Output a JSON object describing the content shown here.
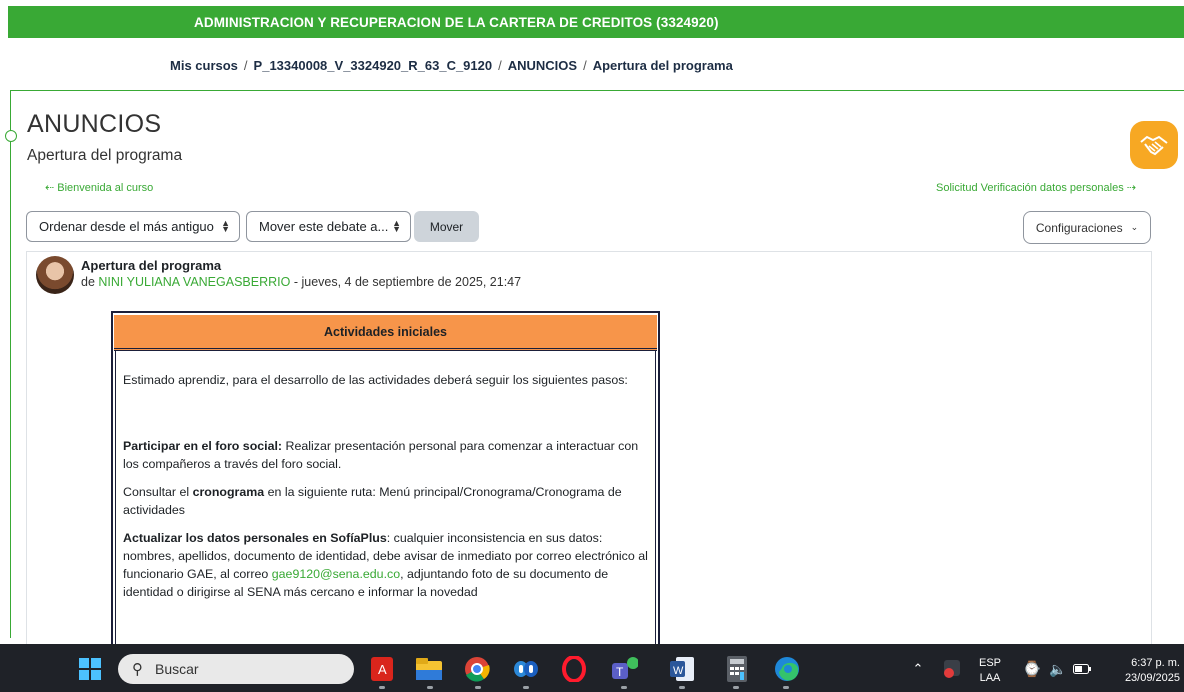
{
  "course_bar": {
    "title": "ADMINISTRACION Y RECUPERACION DE LA CARTERA DE CREDITOS (3324920)"
  },
  "breadcrumb": {
    "items": [
      "Mis cursos",
      "P_13340008_V_3324920_R_63_C_9120",
      "ANUNCIOS",
      "Apertura del programa"
    ],
    "separator": "/"
  },
  "page": {
    "title": "ANUNCIOS",
    "subtitle": "Apertura del programa",
    "prev_link": "Bienvenida al curso",
    "next_link": "Solicitud Verificación datos personales"
  },
  "controls": {
    "order_select": "Ordenar desde el más antiguo",
    "move_select": "Mover este debate a...",
    "move_button": "Mover",
    "settings_button": "Configuraciones"
  },
  "post": {
    "title": "Apertura del programa",
    "by": "de",
    "author": "NINI YULIANA VANEGASBERRIO",
    "date": "- jueves, 4 de septiembre de 2025, 21:47",
    "box_header": "Actividades iniciales",
    "intro": "Estimado aprendiz, para el desarrollo de las actividades deberá seguir los siguientes pasos:",
    "p1_bold": "Participar en el foro social:",
    "p1_text": " Realizar presentación personal para comenzar a interactuar con los compañeros a través del foro social.",
    "p2_pre": "Consultar el ",
    "p2_bold": "cronograma",
    "p2_text": " en la siguiente ruta: Menú principal/Cronograma/Cronograma de actividades",
    "p3_bold": "Actualizar los datos personales en SofíaPlus",
    "p3_text": ": cualquier inconsistencia en sus datos: nombres, apellidos, documento de identidad, debe avisar de inmediato por correo electrónico al funcionario GAE, al correo ",
    "p3_email": "gae9120@sena.edu.co",
    "p3_tail": ", adjuntando foto de su documento de identidad o dirigirse al SENA más cercano e informar la novedad"
  },
  "taskbar": {
    "search_placeholder": "Buscar",
    "lang_top": "ESP",
    "lang_bottom": "LAA",
    "time": "6:37 p. m.",
    "date": "23/09/2025",
    "colors": {
      "accent_green": "#39a935",
      "header_orange": "#f7954a",
      "help_badge": "#f7a823"
    }
  }
}
